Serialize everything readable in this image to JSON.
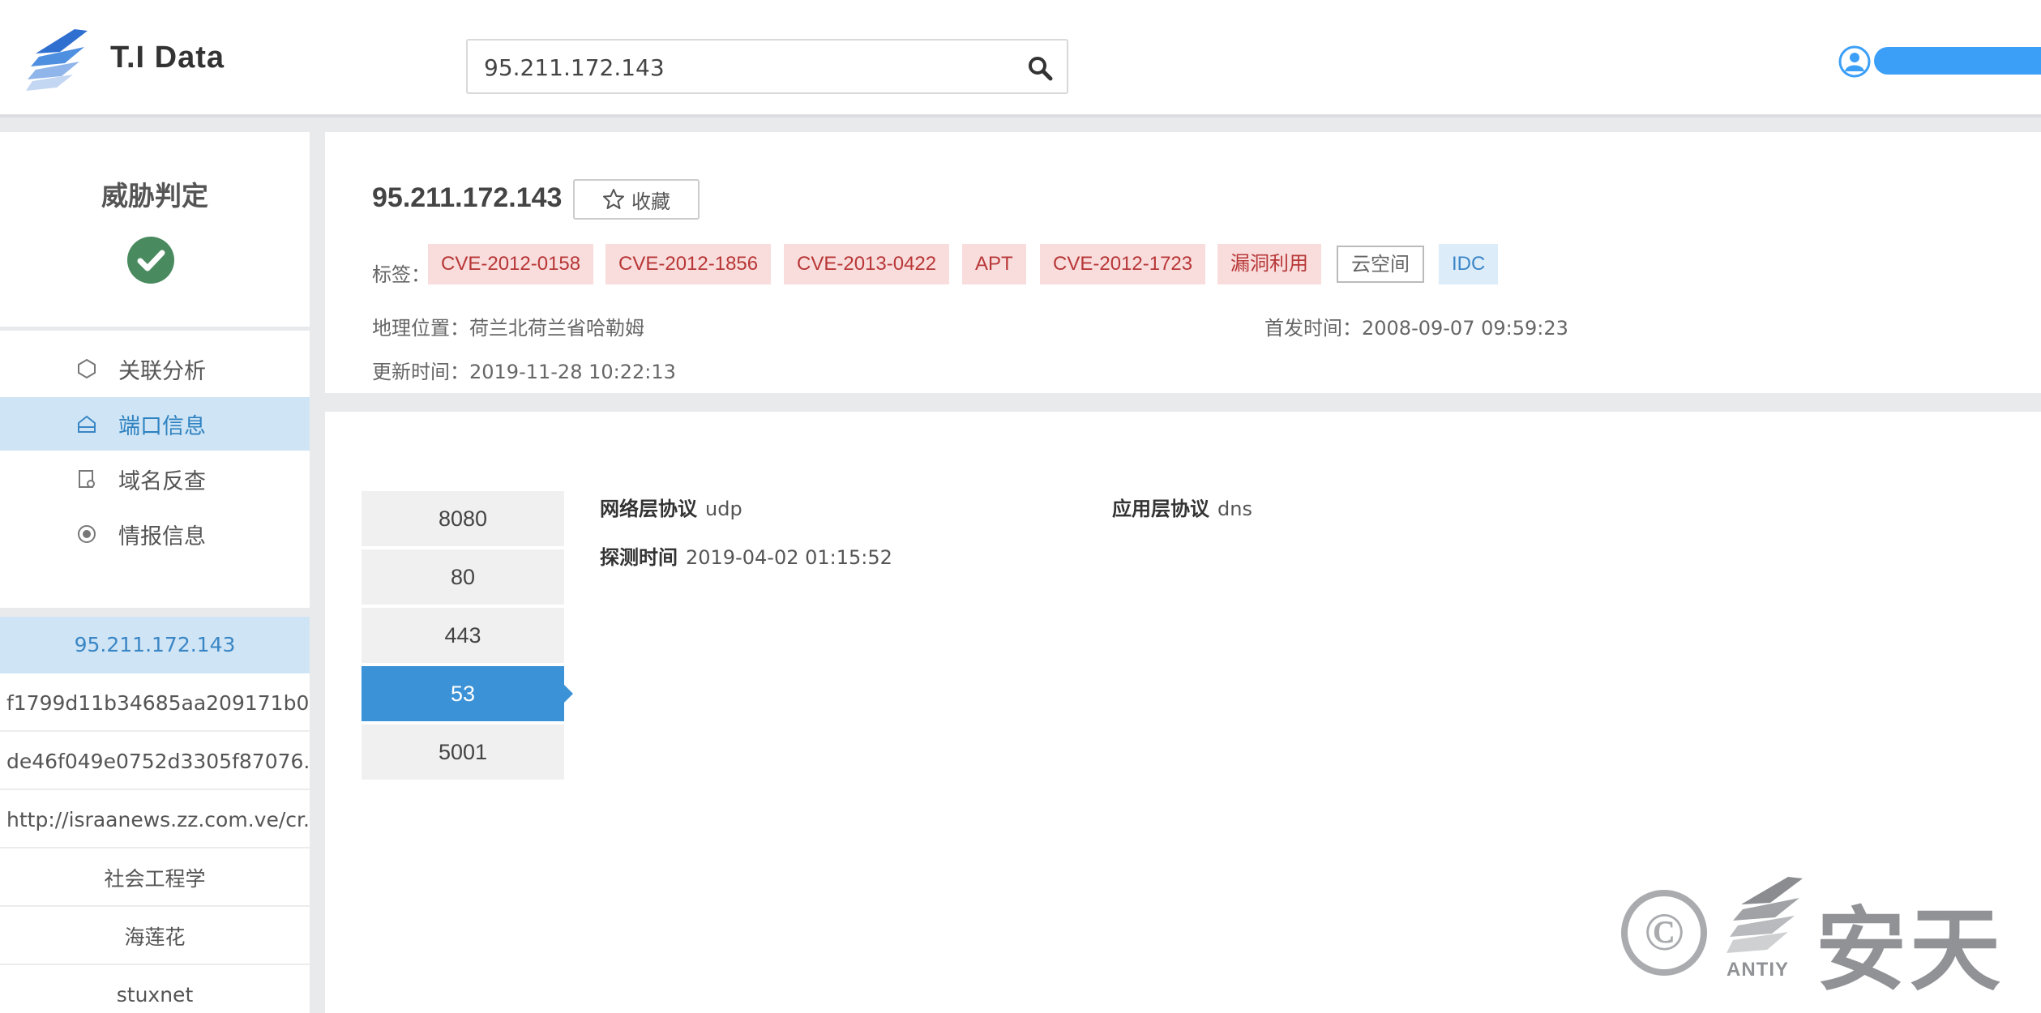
{
  "header": {
    "logo_text": "T.I Data",
    "search_value": "95.211.172.143"
  },
  "sidebar": {
    "verdict_title": "威胁判定",
    "nav": [
      {
        "label": "关联分析",
        "icon": "network-icon",
        "active": false
      },
      {
        "label": "端口信息",
        "icon": "port-icon",
        "active": true
      },
      {
        "label": "域名反查",
        "icon": "domain-doc-icon",
        "active": false
      },
      {
        "label": "情报信息",
        "icon": "intel-icon",
        "active": false
      }
    ],
    "related": [
      {
        "label": "95.211.172.143",
        "active": true
      },
      {
        "label": "f1799d11b34685aa209171b0...",
        "active": false
      },
      {
        "label": "de46f049e0752d3305f87076...",
        "active": false
      },
      {
        "label": "http://israanews.zz.com.ve/cr....",
        "active": false
      },
      {
        "label": "社会工程学",
        "active": false
      },
      {
        "label": "海莲花",
        "active": false
      },
      {
        "label": "stuxnet",
        "active": false
      }
    ]
  },
  "info": {
    "ip": "95.211.172.143",
    "favorite_label": "收藏",
    "tags_label": "标签：",
    "tags": [
      {
        "label": "CVE-2012-0158",
        "style": "red"
      },
      {
        "label": "CVE-2012-1856",
        "style": "red"
      },
      {
        "label": "CVE-2013-0422",
        "style": "red"
      },
      {
        "label": "APT",
        "style": "red"
      },
      {
        "label": "CVE-2012-1723",
        "style": "red"
      },
      {
        "label": "漏洞利用",
        "style": "red"
      },
      {
        "label": "云空间",
        "style": "gray"
      },
      {
        "label": "IDC",
        "style": "blue"
      }
    ],
    "location": "地理位置：荷兰北荷兰省哈勒姆",
    "first_seen": "首发时间：2008-09-07 09:59:23",
    "updated": "更新时间：2019-11-28 10:22:13"
  },
  "ports": {
    "tabs": [
      {
        "label": "8080",
        "active": false
      },
      {
        "label": "80",
        "active": false
      },
      {
        "label": "443",
        "active": false
      },
      {
        "label": "53",
        "active": true
      },
      {
        "label": "5001",
        "active": false
      }
    ],
    "detail": {
      "network_protocol_key": "网络层协议",
      "network_protocol_value": "udp",
      "app_protocol_key": "应用层协议",
      "app_protocol_value": "dns",
      "scan_time_key": "探测时间",
      "scan_time_value": "2019-04-02 01:15:52"
    }
  },
  "watermark": {
    "symbol": "©",
    "brand_sub": "ANTIY",
    "brand_text": "安天"
  },
  "colors": {
    "accent": "#3b92d6",
    "active_bg": "#cfe5f6",
    "tag_red_bg": "#f9dcdc",
    "tag_red_text": "#b83737",
    "verdict_green": "#4a8a5f"
  }
}
